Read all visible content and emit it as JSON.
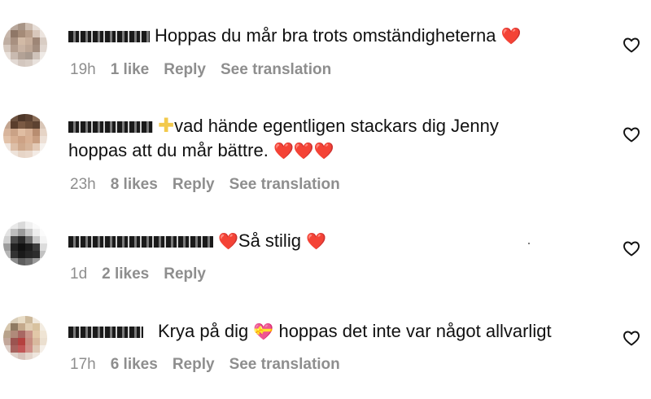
{
  "comments": [
    {
      "username": "plmhm0",
      "text_before": "",
      "text": "Hoppas du mår bra trots omständigheterna",
      "emoji_after": "❤️",
      "text2": "",
      "time": "19h",
      "likes": "1 like",
      "reply": "Reply",
      "translate": "See translation"
    },
    {
      "username": "user",
      "badge": "✚",
      "text": "vad hände egentligen stackars dig Jenny",
      "text2": "hoppas att du mår bättre.",
      "emoji_after2": "❤️❤️❤️",
      "time": "23h",
      "likes": "8 likes",
      "reply": "Reply",
      "translate": "See translation"
    },
    {
      "username": "user",
      "emoji_before": "❤️",
      "text": "Så stilig",
      "emoji_after": "❤️",
      "time": "1d",
      "likes": "2 likes",
      "reply": "Reply"
    },
    {
      "username": "user",
      "text": "Krya på dig",
      "emoji_mid": "💝",
      "text_rest": "hoppas det inte var något allvarligt",
      "time": "17h",
      "likes": "6 likes",
      "reply": "Reply",
      "translate": "See translation"
    }
  ],
  "icons": {
    "like": "heart-outline-icon"
  },
  "colors": {
    "meta": "#8e8e8e",
    "heart": "#e0233a",
    "text": "#111111"
  }
}
